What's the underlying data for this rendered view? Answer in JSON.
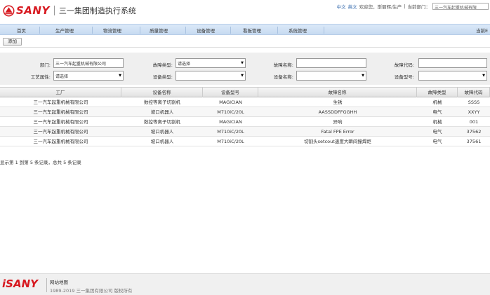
{
  "header": {
    "brand": "SANY",
    "system_title": "三一集团制造执行系统",
    "lang_cn": "中文",
    "lang_en": "英文",
    "welcome": "欢迎您，斯丽辉/生产",
    "current_dept_label": "当前部门：",
    "current_dept_value": "三一汽车起重机械有限"
  },
  "nav": {
    "items": [
      "首页",
      "生产管理",
      "物流管理",
      "质量管理",
      "设备管理",
      "看板管理",
      "系统管理"
    ],
    "right_label": "当前E"
  },
  "toolbar": {
    "add_label": "添加"
  },
  "filter": {
    "dept_label": "部门:",
    "dept_value": "三一汽车起重机械有限公司",
    "fault_type_label": "故障类型:",
    "fault_type_value": "请选择",
    "fault_name_label": "故障名称:",
    "fault_name_value": "",
    "fault_code_label": "故障代码:",
    "fault_code_value": "",
    "process_attr_label": "工艺属性:",
    "process_attr_value": "请选择",
    "equip_type_label": "设备类型:",
    "equip_type_value": "",
    "equip_name_label": "设备名称:",
    "equip_name_value": "",
    "equip_model_label": "设备型号:",
    "equip_model_value": ""
  },
  "table": {
    "columns": [
      "工厂",
      "设备名称",
      "设备型号",
      "故障名称",
      "故障类型",
      "故障代码"
    ],
    "rows": [
      [
        "三一汽车起重机械有限公司",
        "数控等离子切割机",
        "MAGICIAN",
        "生锈",
        "机械",
        "SSSS"
      ],
      [
        "三一汽车起重机械有限公司",
        "坡口机器人",
        "M710iC/20L",
        "AASSDDFFGGHH",
        "电气",
        "XXYY"
      ],
      [
        "三一汽车起重机械有限公司",
        "数控等离子切割机",
        "MAGICIAN",
        "异响",
        "机械",
        "001"
      ],
      [
        "三一汽车起重机械有限公司",
        "坡口机器人",
        "M710iC/20L",
        "Fatal FPE Error",
        "电气",
        "37562"
      ],
      [
        "三一汽车起重机械有限公司",
        "坡口机器人",
        "M710iC/20L",
        "切割头setcout速度大瞬间撞焊炬",
        "电气",
        "37561"
      ]
    ],
    "pager_text": "显示第 1 到第 5 条记录，总共 5 条记录"
  },
  "footer": {
    "brand": "SANY",
    "sitemap": "网站地图",
    "copyright": "1989-2019 三一集团有限公司 版权所有"
  },
  "colors": {
    "brand_red": "#d71920",
    "nav_blue": "#c7dbf1"
  }
}
